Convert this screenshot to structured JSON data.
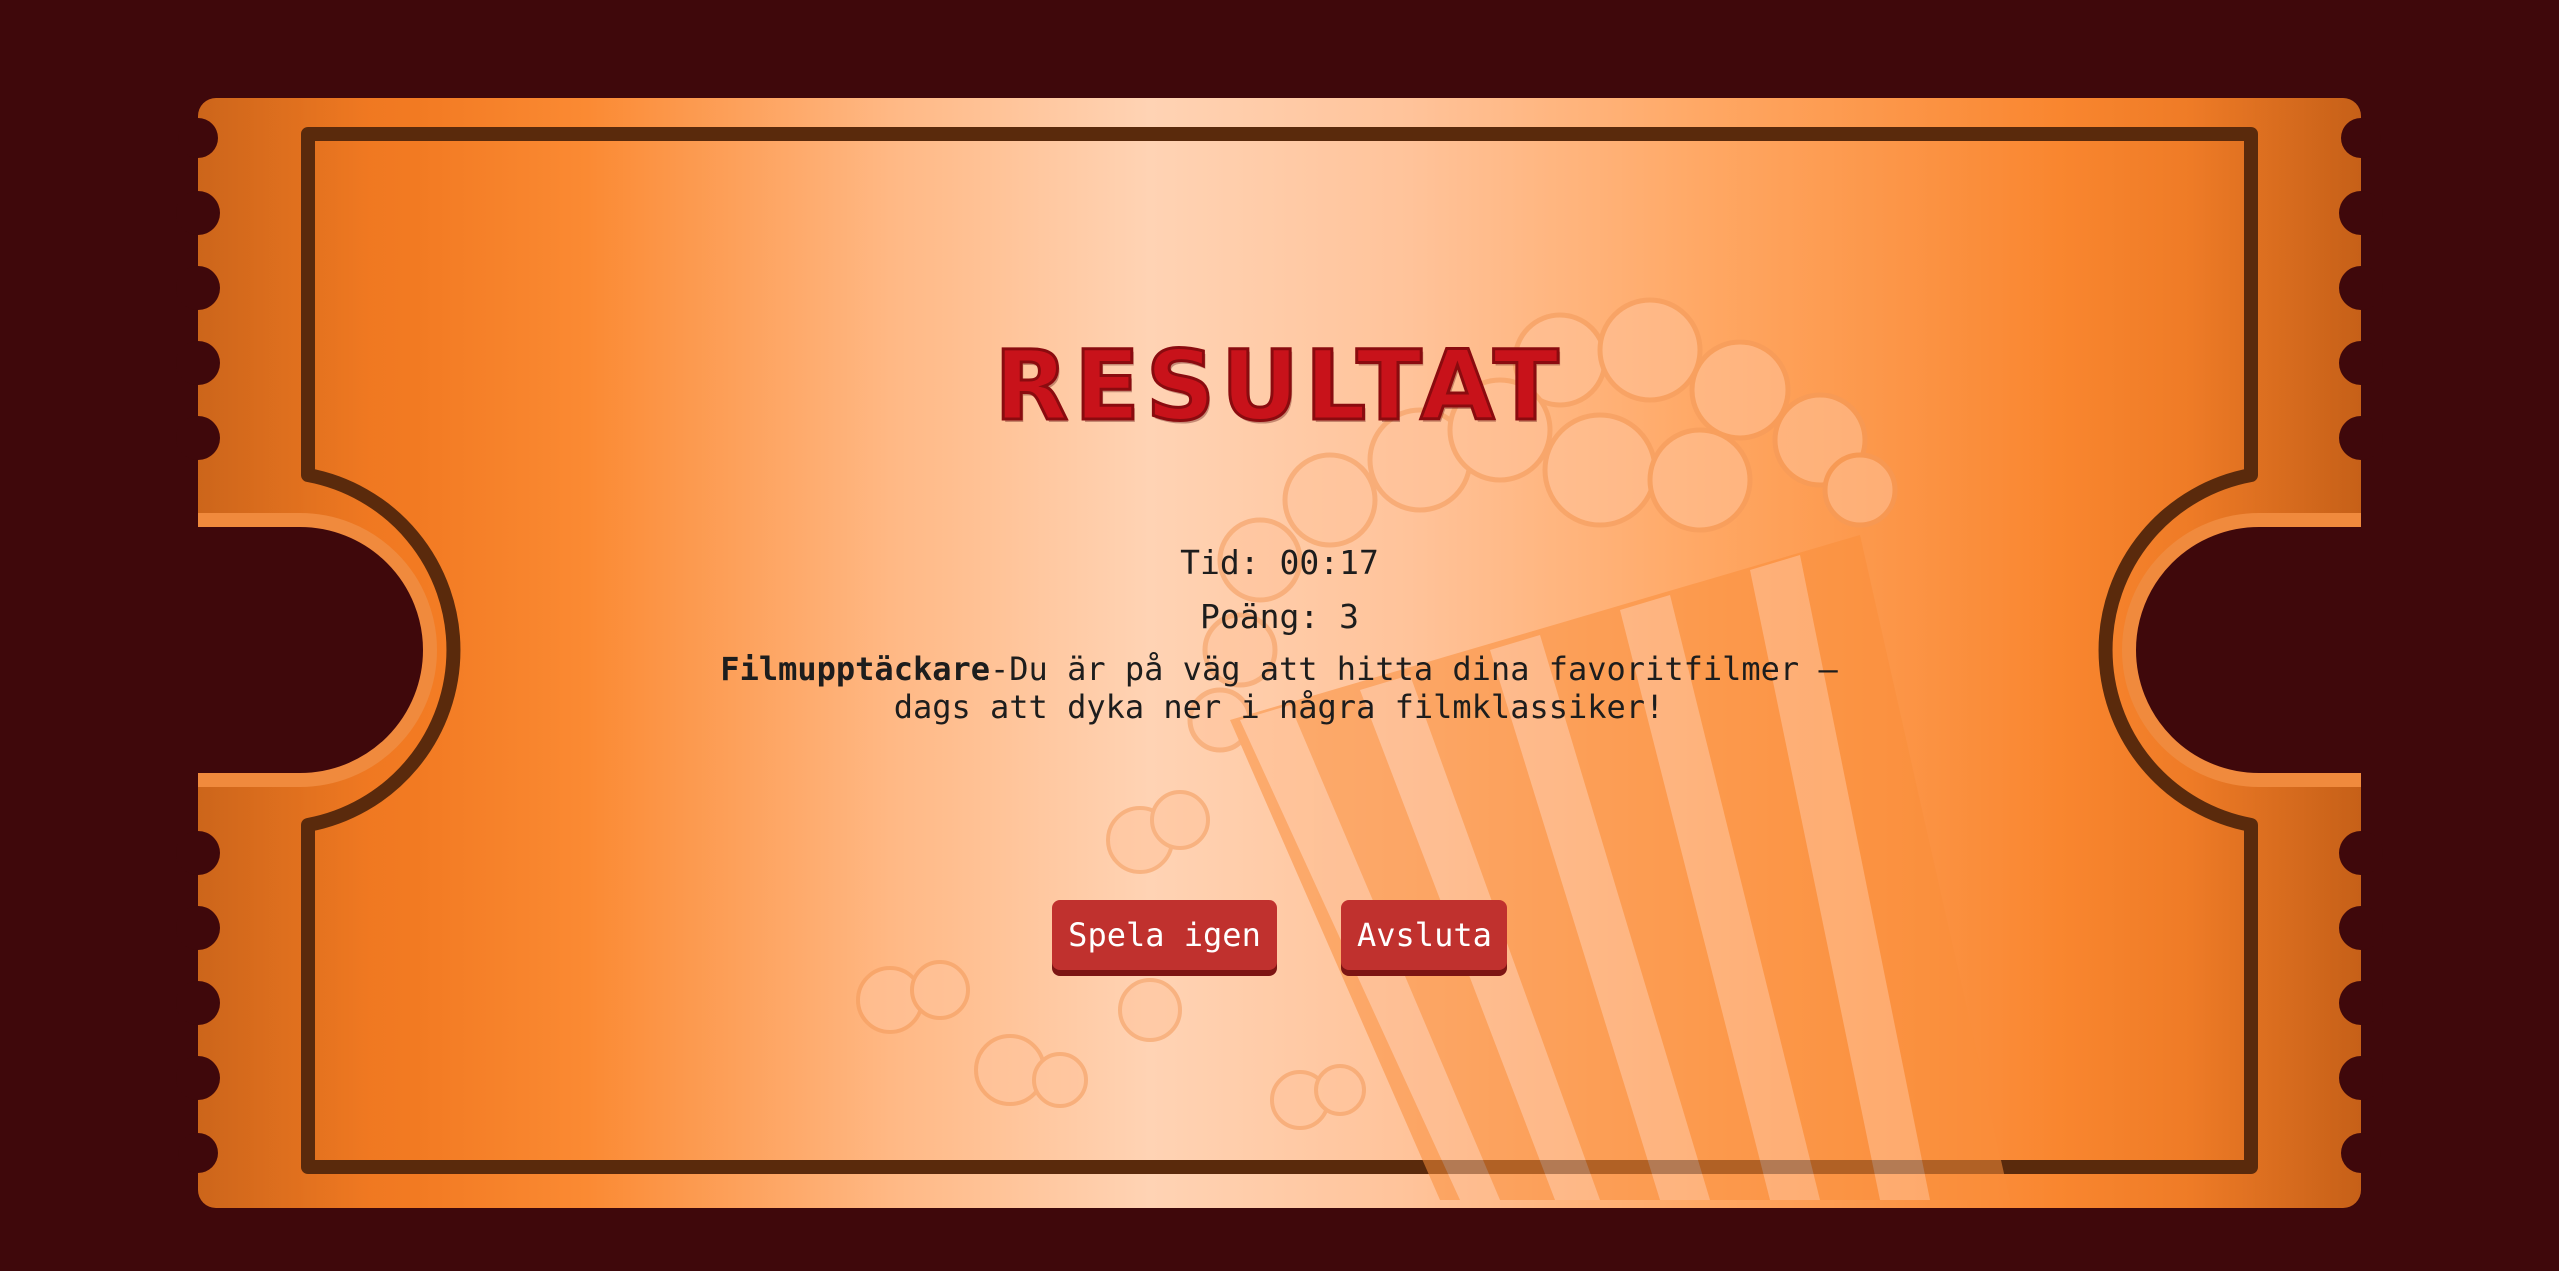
{
  "result": {
    "title": "RESULTAT",
    "time_text": "Tid: 00:17",
    "score_text": "Poäng: 3",
    "rank_name": "Filmupptäckare",
    "rank_description": "-Du är på väg att hitta dina favoritfilmer – dags att dyka ner i några filmklassiker!"
  },
  "buttons": {
    "play_again": "Spela igen",
    "quit": "Avsluta"
  },
  "colors": {
    "background": "#3f080b",
    "ticket_orange": "#f47a26",
    "ticket_highlight": "#ffd2b3",
    "title_red": "#c8121a",
    "button_red": "#c0312e"
  },
  "decorations": {
    "background_art": "popcorn-bucket-icon"
  }
}
